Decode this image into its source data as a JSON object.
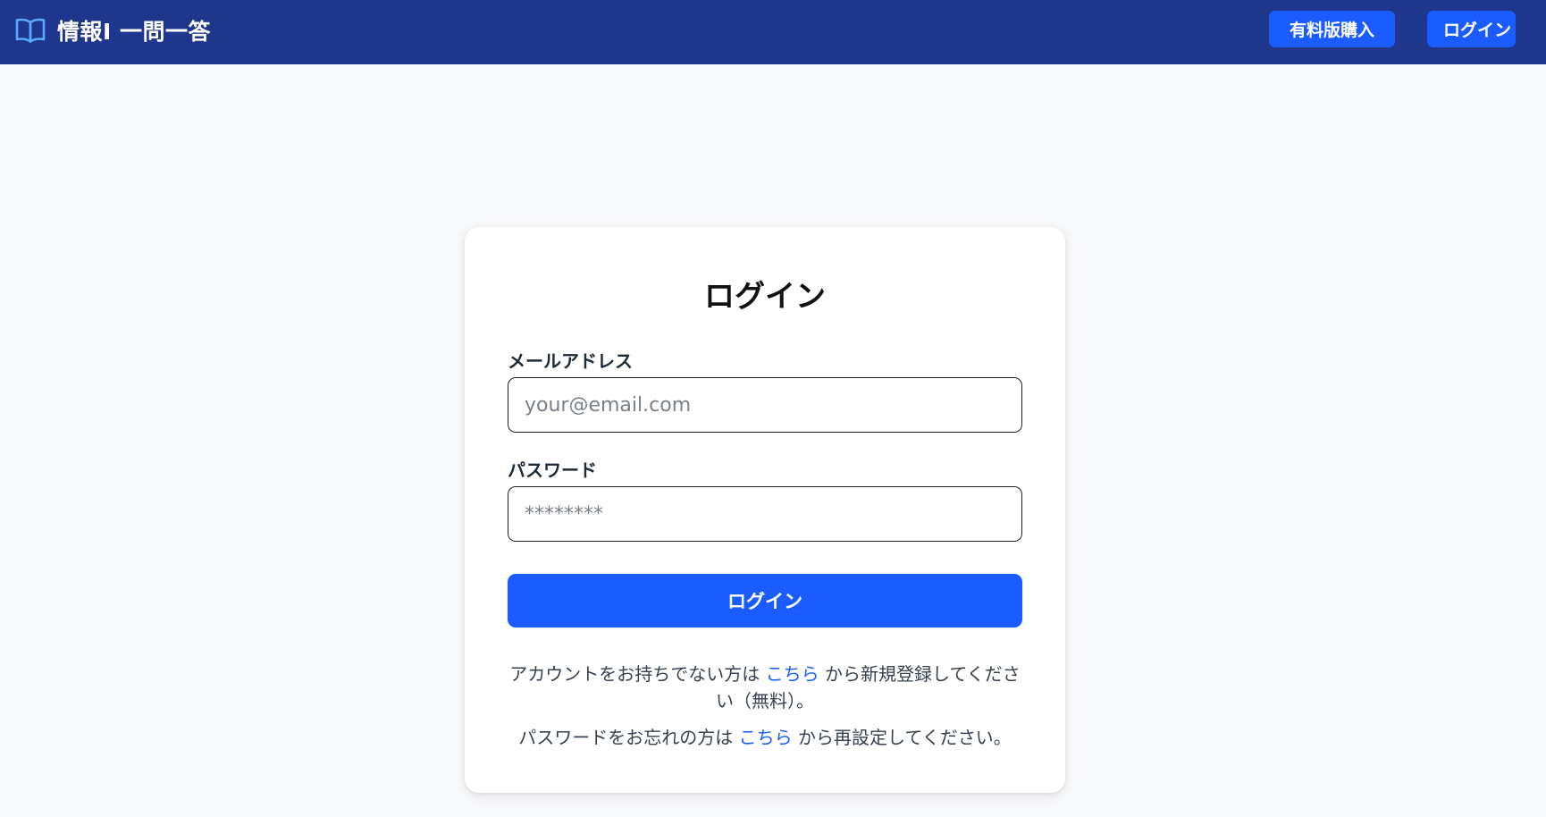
{
  "header": {
    "title": "情報Ⅰ 一問一答",
    "icon": "book-icon",
    "purchase_label": "有料版購入",
    "login_label": "ログイン"
  },
  "login_card": {
    "title": "ログイン",
    "email_label": "メールアドレス",
    "email_placeholder": "your@email.com",
    "email_value": "",
    "password_label": "パスワード",
    "password_placeholder": "********",
    "password_value": "",
    "submit_label": "ログイン",
    "register_prefix": "アカウントをお持ちでない方は",
    "register_link": "こちら",
    "register_suffix": "から新規登録してください（無料）。",
    "reset_prefix": "パスワードをお忘れの方は",
    "reset_link": "こちら",
    "reset_suffix": "から再設定してください。"
  },
  "colors": {
    "header_bg": "#1e378c",
    "accent": "#1a5cff",
    "page_bg": "#f8f9fb",
    "card_bg": "#ffffff"
  }
}
